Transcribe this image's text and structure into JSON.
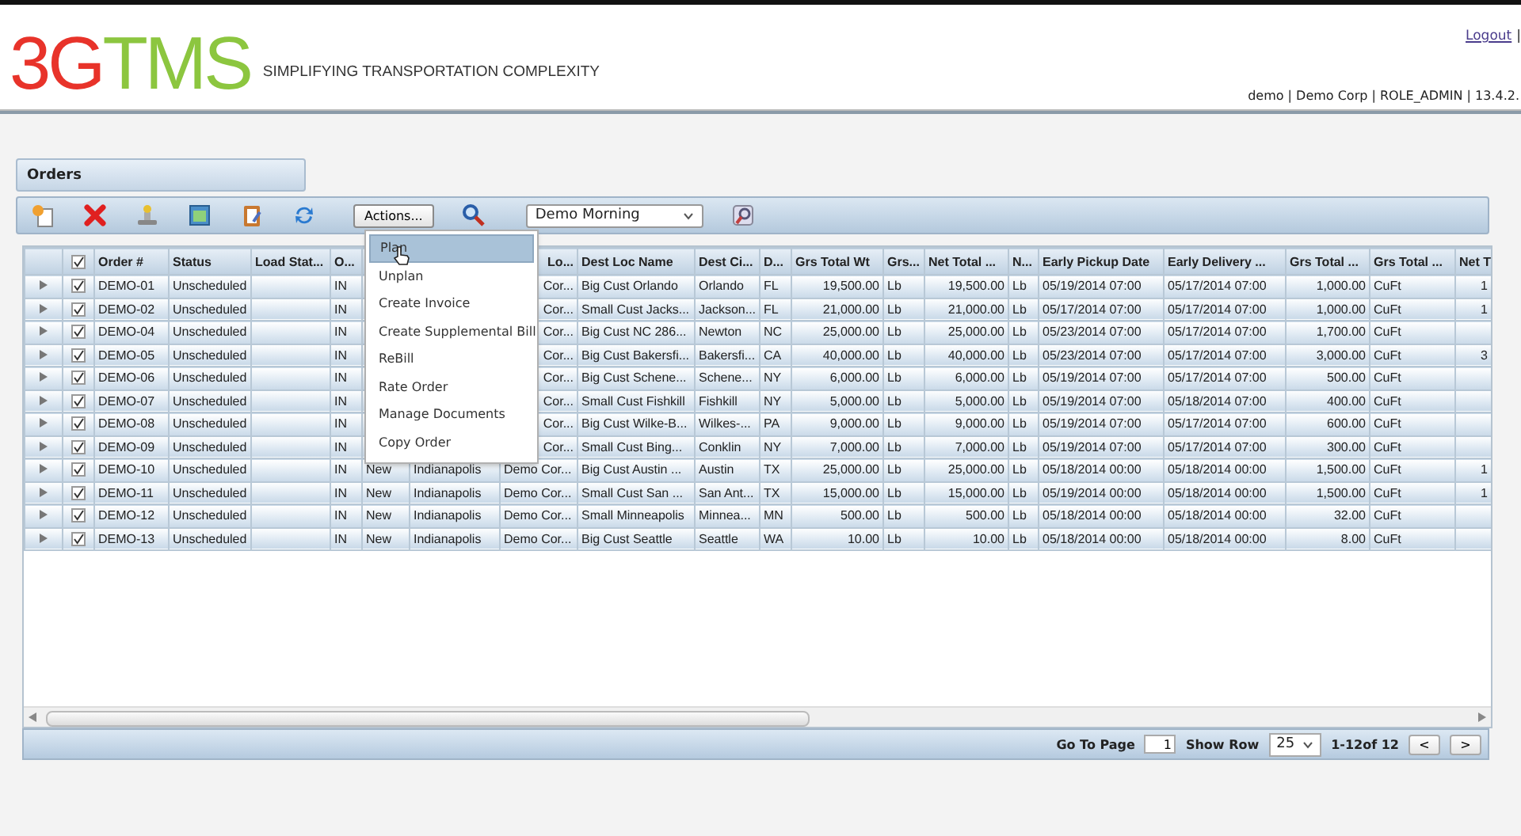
{
  "header": {
    "logo": {
      "lead": "3G",
      "rest": "TMS"
    },
    "tagline": "SIMPLIFYING TRANSPORTATION COMPLEXITY",
    "logout": "Logout",
    "separator": "|",
    "user_info": "demo | Demo Corp | ROLE_ADMIN | 13.4.2."
  },
  "panel": {
    "title": "Orders"
  },
  "toolbar": {
    "actions_button": "Actions...",
    "view_select": "Demo Morning"
  },
  "actions_menu": {
    "items": [
      {
        "label": "Plan",
        "selected": true
      },
      {
        "label": "Unplan",
        "selected": false
      },
      {
        "label": "Create Invoice",
        "selected": false
      },
      {
        "label": "Create Supplemental Bill",
        "selected": false
      },
      {
        "label": "ReBill",
        "selected": false
      },
      {
        "label": "Rate Order",
        "selected": false
      },
      {
        "label": "Manage Documents",
        "selected": false
      },
      {
        "label": "Copy Order",
        "selected": false
      }
    ]
  },
  "table": {
    "all_checked": true,
    "columns": [
      {
        "label": "Order #",
        "kind": "text"
      },
      {
        "label": "Status",
        "kind": "text"
      },
      {
        "label": "Load Stat...",
        "kind": "text"
      },
      {
        "label": "O...",
        "kind": "text"
      },
      {
        "kind": "text"
      },
      {
        "kind": "text"
      },
      {
        "label": "Lo...",
        "kind": "text"
      },
      {
        "label": "Dest Loc Name",
        "kind": "text"
      },
      {
        "label": "Dest Ci...",
        "kind": "text"
      },
      {
        "label": "D...",
        "kind": "text"
      },
      {
        "label": "Grs Total Wt",
        "kind": "number"
      },
      {
        "label": "Grs...",
        "kind": "text"
      },
      {
        "label": "Net Total ...",
        "kind": "number"
      },
      {
        "label": "N...",
        "kind": "text"
      },
      {
        "label": "Early Pickup Date",
        "kind": "text"
      },
      {
        "label": "Early Delivery ...",
        "kind": "text"
      },
      {
        "label": "Grs Total ...",
        "kind": "number"
      },
      {
        "label": "Grs Total ...",
        "kind": "text"
      },
      {
        "label": "Net T",
        "kind": "number"
      }
    ],
    "rows": [
      {
        "checked": true,
        "cells": [
          "DEMO-01",
          "Unscheduled",
          null,
          "IN",
          null,
          null,
          "Cor...",
          "Big Cust Orlando",
          "Orlando",
          "FL",
          "19,500.00",
          "Lb",
          "19,500.00",
          "Lb",
          "05/19/2014 07:00",
          "05/17/2014 07:00",
          "1,000.00",
          "CuFt",
          "1"
        ]
      },
      {
        "checked": true,
        "cells": [
          "DEMO-02",
          "Unscheduled",
          null,
          "IN",
          null,
          null,
          "Cor...",
          "Small Cust Jacks...",
          "Jackson...",
          "FL",
          "21,000.00",
          "Lb",
          "21,000.00",
          "Lb",
          "05/17/2014 07:00",
          "05/17/2014 07:00",
          "1,000.00",
          "CuFt",
          "1"
        ]
      },
      {
        "checked": true,
        "cells": [
          "DEMO-04",
          "Unscheduled",
          null,
          "IN",
          null,
          null,
          "Cor...",
          "Big Cust NC 286...",
          "Newton",
          "NC",
          "25,000.00",
          "Lb",
          "25,000.00",
          "Lb",
          "05/23/2014 07:00",
          "05/17/2014 07:00",
          "1,700.00",
          "CuFt",
          null
        ]
      },
      {
        "checked": true,
        "cells": [
          "DEMO-05",
          "Unscheduled",
          null,
          "IN",
          null,
          null,
          "Cor...",
          "Big Cust Bakersfi...",
          "Bakersfi...",
          "CA",
          "40,000.00",
          "Lb",
          "40,000.00",
          "Lb",
          "05/23/2014 07:00",
          "05/17/2014 07:00",
          "3,000.00",
          "CuFt",
          "3"
        ]
      },
      {
        "checked": true,
        "cells": [
          "DEMO-06",
          "Unscheduled",
          null,
          "IN",
          null,
          null,
          "Cor...",
          "Big Cust Schene...",
          "Schene...",
          "NY",
          "6,000.00",
          "Lb",
          "6,000.00",
          "Lb",
          "05/19/2014 07:00",
          "05/17/2014 07:00",
          "500.00",
          "CuFt",
          null
        ]
      },
      {
        "checked": true,
        "cells": [
          "DEMO-07",
          "Unscheduled",
          null,
          "IN",
          null,
          null,
          "Cor...",
          "Small Cust Fishkill",
          "Fishkill",
          "NY",
          "5,000.00",
          "Lb",
          "5,000.00",
          "Lb",
          "05/19/2014 07:00",
          "05/18/2014 07:00",
          "400.00",
          "CuFt",
          null
        ]
      },
      {
        "checked": true,
        "cells": [
          "DEMO-08",
          "Unscheduled",
          null,
          "IN",
          null,
          null,
          "Cor...",
          "Big Cust Wilke-B...",
          "Wilkes-...",
          "PA",
          "9,000.00",
          "Lb",
          "9,000.00",
          "Lb",
          "05/19/2014 07:00",
          "05/17/2014 07:00",
          "600.00",
          "CuFt",
          null
        ]
      },
      {
        "checked": true,
        "cells": [
          "DEMO-09",
          "Unscheduled",
          null,
          "IN",
          null,
          null,
          "Cor...",
          "Small Cust Bing...",
          "Conklin",
          "NY",
          "7,000.00",
          "Lb",
          "7,000.00",
          "Lb",
          "05/19/2014 07:00",
          "05/17/2014 07:00",
          "300.00",
          "CuFt",
          null
        ]
      },
      {
        "checked": true,
        "cells": [
          "DEMO-10",
          "Unscheduled",
          null,
          "IN",
          "New",
          "Indianapolis",
          "Demo Cor...",
          "Big Cust Austin ...",
          "Austin",
          "TX",
          "25,000.00",
          "Lb",
          "25,000.00",
          "Lb",
          "05/18/2014 00:00",
          "05/18/2014 00:00",
          "1,500.00",
          "CuFt",
          "1"
        ]
      },
      {
        "checked": true,
        "cells": [
          "DEMO-11",
          "Unscheduled",
          null,
          "IN",
          "New",
          "Indianapolis",
          "Demo Cor...",
          "Small Cust San ...",
          "San Ant...",
          "TX",
          "15,000.00",
          "Lb",
          "15,000.00",
          "Lb",
          "05/19/2014 00:00",
          "05/18/2014 00:00",
          "1,500.00",
          "CuFt",
          "1"
        ]
      },
      {
        "checked": true,
        "cells": [
          "DEMO-12",
          "Unscheduled",
          null,
          "IN",
          "New",
          "Indianapolis",
          "Demo Cor...",
          "Small Minneapolis",
          "Minnea...",
          "MN",
          "500.00",
          "Lb",
          "500.00",
          "Lb",
          "05/18/2014 00:00",
          "05/18/2014 00:00",
          "32.00",
          "CuFt",
          null
        ]
      },
      {
        "checked": true,
        "cells": [
          "DEMO-13",
          "Unscheduled",
          null,
          "IN",
          "New",
          "Indianapolis",
          "Demo Cor...",
          "Big Cust Seattle",
          "Seattle",
          "WA",
          "10.00",
          "Lb",
          "10.00",
          "Lb",
          "05/18/2014 00:00",
          "05/18/2014 00:00",
          "8.00",
          "CuFt",
          null
        ]
      }
    ]
  },
  "pager": {
    "go_to_label": "Go To Page",
    "page": "1",
    "show_row_label": "Show Row",
    "rows_per_page": "25",
    "range": "1-12of 12",
    "prev": "<",
    "next": ">"
  }
}
